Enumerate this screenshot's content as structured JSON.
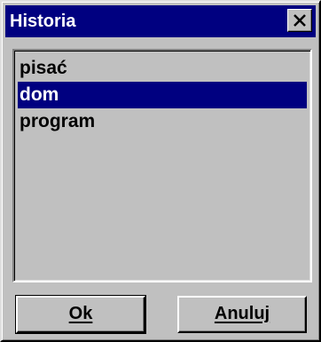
{
  "window": {
    "title": "Historia"
  },
  "titlebar": {
    "close_icon": "close-icon"
  },
  "history_list": {
    "items": [
      {
        "label": "pisać",
        "selected": false
      },
      {
        "label": "dom",
        "selected": true
      },
      {
        "label": "program",
        "selected": false
      }
    ]
  },
  "buttons": {
    "ok_label": "Ok",
    "cancel_label": "Anuluj"
  },
  "colors": {
    "titlebar": "#000080",
    "selection": "#000080",
    "face": "#c0c0c0"
  }
}
